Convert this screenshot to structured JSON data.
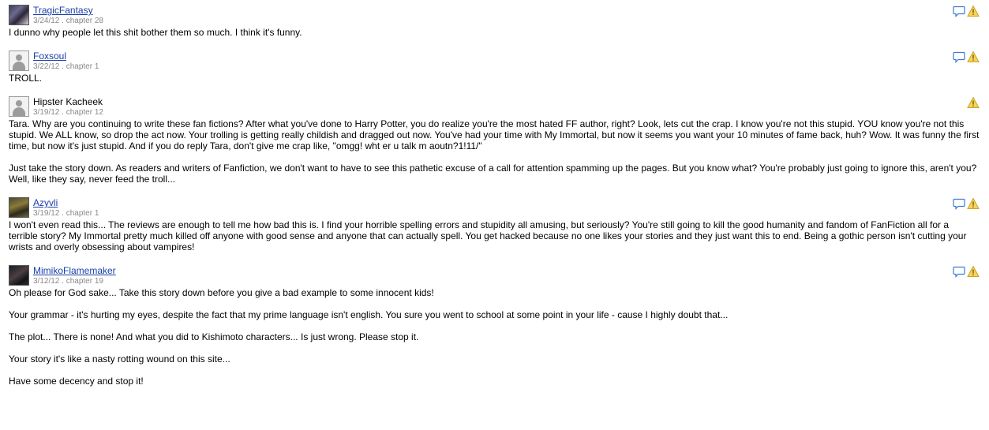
{
  "reviews": [
    {
      "reviewer": "TragicFantasy",
      "linked": true,
      "avatar": "custom",
      "meta": "3/24/12 . chapter 28",
      "has_reply": true,
      "paragraphs": [
        "I dunno why people let this shit bother them so much. I think it's funny."
      ]
    },
    {
      "reviewer": "Foxsoul",
      "linked": true,
      "avatar": "default",
      "meta": "3/22/12 . chapter 1",
      "has_reply": true,
      "paragraphs": [
        "TROLL."
      ]
    },
    {
      "reviewer": "Hipster Kacheek",
      "linked": false,
      "avatar": "default",
      "meta": "3/19/12 . chapter 12",
      "has_reply": false,
      "paragraphs": [
        "Tara. Why are you continuing to write these fan fictions? After what you've done to Harry Potter, you do realize you're the most hated FF author, right? Look, lets cut the crap. I know you're not this stupid. YOU know you're not this stupid. We ALL know, so drop the act now. Your trolling is getting really childish and dragged out now. You've had your time with My Immortal, but now it seems you want your 10 minutes of fame back, huh? Wow. It was funny the first time, but now it's just stupid. And if you do reply Tara, don't give me crap like, \"omgg! wht er u talk m aoutn?1!11/\"",
        "Just take the story down. As readers and writers of Fanfiction, we don't want to have to see this pathetic excuse of a call for attention spamming up the pages. But you know what? You're probably just going to ignore this, aren't you? Well, like they say, never feed the troll..."
      ]
    },
    {
      "reviewer": "Azyvli",
      "linked": true,
      "avatar": "custom",
      "meta": "3/19/12 . chapter 1",
      "has_reply": true,
      "paragraphs": [
        "I won't even read this... The reviews are enough to tell me how bad this is. I find your horrible spelling errors and stupidity all amusing, but seriously? You're still going to kill the good humanity and fandom of FanFiction all for a terrible story? My Immortal pretty much killed off anyone with good sense and anyone that can actually spell. You get hacked because no one likes your stories and they just want this to end. Being a gothic person isn't cutting your wrists and overly obsessing about vampires!"
      ]
    },
    {
      "reviewer": "MimikoFlamemaker",
      "linked": true,
      "avatar": "custom",
      "meta": "3/12/12 . chapter 19",
      "has_reply": true,
      "paragraphs": [
        "Oh please for God sake... Take this story down before you give a bad example to some innocent kids!",
        "Your grammar - it's hurting my eyes, despite the fact that my prime language isn't english. You sure you went to school at some point in your life - cause I highly doubt that...",
        "The plot... There is none! And what you did to Kishimoto characters... Is just wrong. Please stop it.",
        "Your story it's like a nasty rotting wound on this site...",
        "Have some decency and stop it!"
      ]
    }
  ],
  "icons": {
    "reply": "speech-bubble-icon",
    "report": "warning-triangle-icon"
  },
  "colors": {
    "link": "#1a3ea8",
    "meta": "#888888",
    "reply_icon": "#3b7bd4",
    "warning_icon": "#f0c419"
  }
}
